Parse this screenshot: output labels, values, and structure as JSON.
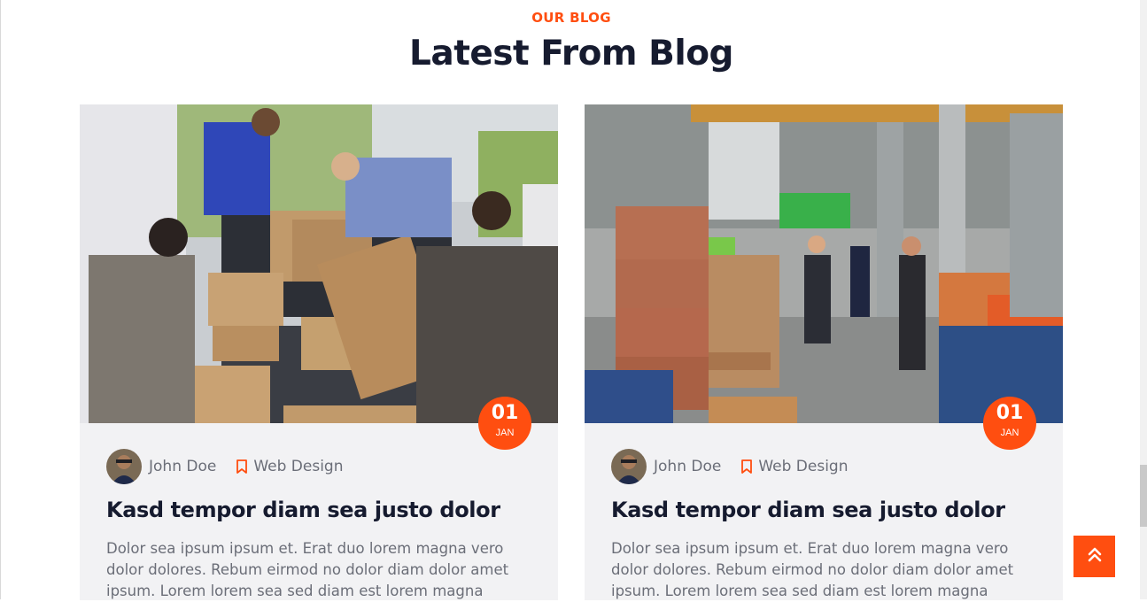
{
  "section": {
    "eyebrow": "OUR BLOG",
    "title": "Latest From Blog"
  },
  "colors": {
    "accent": "#ff4e10",
    "heading": "#161b2f",
    "card_bg": "#f2f2f4",
    "muted_text": "#6b6e78"
  },
  "posts": [
    {
      "image": "volunteers-loading-boxes-photo",
      "date_day": "01",
      "date_month": "JAN",
      "author": "John Doe",
      "category": "Web Design",
      "title": "Kasd tempor diam sea justo dolor",
      "excerpt": "Dolor sea ipsum ipsum et. Erat duo lorem magna vero dolor dolores. Rebum eirmod no dolor diam dolor amet ipsum. Lorem lorem sea sed diam est lorem magna"
    },
    {
      "image": "warehouse-workers-photo",
      "date_day": "01",
      "date_month": "JAN",
      "author": "John Doe",
      "category": "Web Design",
      "title": "Kasd tempor diam sea justo dolor",
      "excerpt": "Dolor sea ipsum ipsum et. Erat duo lorem magna vero dolor dolores. Rebum eirmod no dolor diam dolor amet ipsum. Lorem lorem sea sed diam est lorem magna"
    }
  ],
  "icons": {
    "category": "bookmark-icon",
    "back_to_top": "double-chevron-up-icon"
  }
}
